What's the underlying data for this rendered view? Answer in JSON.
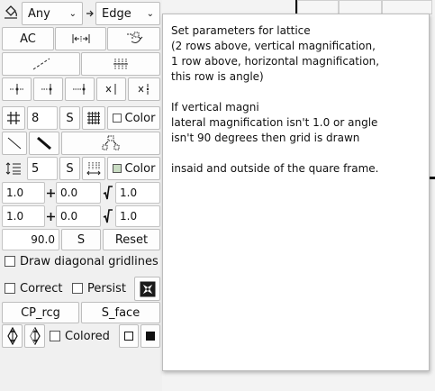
{
  "toolbar": {
    "fill_mode_select": "Any",
    "edge_select": "Edge",
    "ac_button": "AC",
    "s_label": "S",
    "color_label": "Color",
    "grid_spacing": "8",
    "line_spacing": "5",
    "mag_row1": {
      "a": "1.0",
      "b": "0.0",
      "c": "1.0"
    },
    "mag_row2": {
      "a": "1.0",
      "b": "0.0",
      "c": "1.0"
    },
    "angle_value": "90.0",
    "reset_button": "Reset",
    "draw_diagonal_label": "Draw diagonal gridlines",
    "correct_label": "Correct",
    "persist_label": "Persist",
    "cp_rcg_button": "CP_rcg",
    "s_face_button": "S_face",
    "colored_label": "Colored"
  },
  "tooltip": {
    "lines_1": [
      "Set parameters for lattice",
      "(2 rows above, vertical magnification,",
      "1 row above, horizontal magnification,",
      "this row is angle)"
    ],
    "lines_2": [
      "If vertical magni",
      "lateral magnification isn't 1.0 or angle",
      "isn't 90 degrees then grid is drawn"
    ],
    "lines_3": [
      "insaid and outside of the quare frame."
    ]
  }
}
